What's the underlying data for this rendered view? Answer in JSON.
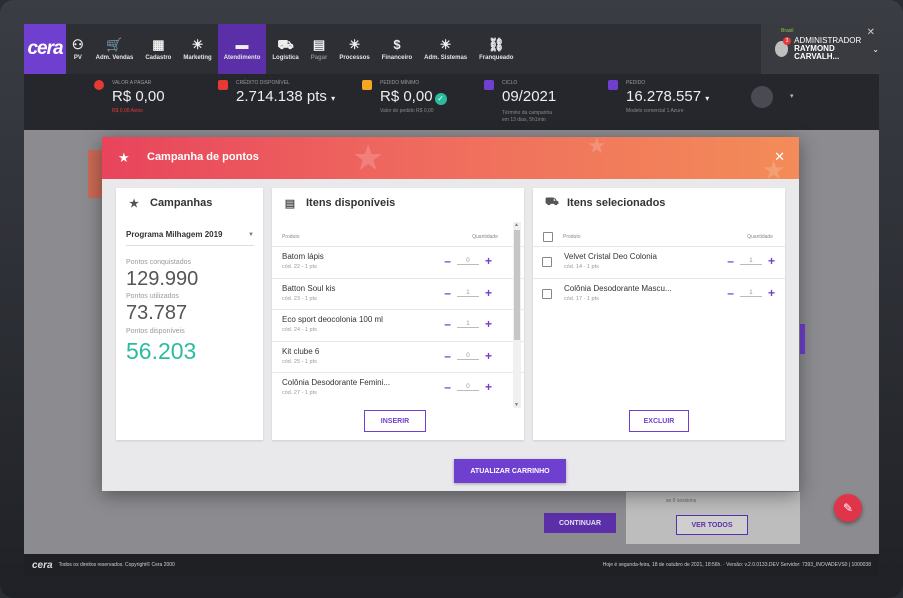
{
  "nav": {
    "logo": "cera",
    "items": [
      {
        "label": "PV",
        "icon": "user-group-icon",
        "glyph": "⚇"
      },
      {
        "label": "Adm. Vendas",
        "icon": "cart-icon",
        "glyph": "🛒"
      },
      {
        "label": "Cadastro",
        "icon": "id-card-icon",
        "glyph": "▦"
      },
      {
        "label": "Marketing",
        "icon": "lightbulb-icon",
        "glyph": "☀"
      },
      {
        "label": "Atendimento",
        "icon": "chat-icon",
        "glyph": "▬"
      },
      {
        "label": "Logística",
        "icon": "truck-icon",
        "glyph": "⛟"
      },
      {
        "label": "Pagar",
        "icon": "invoice-icon",
        "glyph": "▤"
      },
      {
        "label": "Processos",
        "icon": "lightbulb-icon",
        "glyph": "☀"
      },
      {
        "label": "Financeiro",
        "icon": "dollar-icon",
        "glyph": "$"
      },
      {
        "label": "Adm. Sistemas",
        "icon": "lightbulb-icon",
        "glyph": "☀"
      },
      {
        "label": "Franqueado",
        "icon": "network-icon",
        "glyph": "⛓"
      }
    ],
    "active_index": 4,
    "user": {
      "country": "Brasil",
      "role": "ADMINISTRADOR",
      "name": "RAYMOND CARVALH...",
      "badge": "3"
    }
  },
  "info": {
    "valor_pagar": {
      "label": "VALOR A PAGAR",
      "value": "R$ 0,00",
      "sub": "R$ 0,00 Aviso"
    },
    "credito": {
      "label": "CRÉDITO DISPONÍVEL",
      "value": "2.714.138 pts"
    },
    "pedido_minimo": {
      "label": "PEDIDO MÍNIMO",
      "value": "R$ 0,00",
      "sub": "Valor do pedido R$ 0,00"
    },
    "ciclo": {
      "label": "CICLO",
      "value": "09/2021",
      "sub1": "Término da campanha",
      "sub2": "em 13 dias, 5h1min"
    },
    "pedido": {
      "label": "PEDIDO",
      "value": "16.278.557",
      "sub": "Modelo comercial 1 Azure"
    },
    "colors": {
      "red": "#e53935",
      "orange": "#f5a623",
      "purple": "#6f3fd0",
      "green": "#2bbca0"
    }
  },
  "modal": {
    "title": "Campanha de pontos",
    "campanhas": {
      "header": "Campanhas",
      "selected": "Programa Milhagem 2019",
      "conquistados_label": "Pontos conquistados",
      "conquistados": "129.990",
      "utilizados_label": "Pontos utilizados",
      "utilizados": "73.787",
      "disponiveis_label": "Pontos disponíveis",
      "disponiveis": "56.203"
    },
    "disponiveis": {
      "header": "Itens disponíveis",
      "col_produto": "Produto",
      "col_quantidade": "Quantidade",
      "items": [
        {
          "name": "Batom lápis",
          "code": "cód. 22 - 1 pts",
          "qty": "0"
        },
        {
          "name": "Batton Soul kis",
          "code": "cód. 23 - 1 pts",
          "qty": "1"
        },
        {
          "name": "Eco sport deocolonia 100 ml",
          "code": "cód. 24 - 1 pts",
          "qty": "1"
        },
        {
          "name": "Kit clube 6",
          "code": "cód. 25 - 1 pts",
          "qty": "0"
        },
        {
          "name": "Colônia Desodorante Femini...",
          "code": "cód. 27 - 1 pts",
          "qty": "0"
        }
      ],
      "button": "INSERIR"
    },
    "selecionados": {
      "header": "Itens selecionados",
      "col_produto": "Produto",
      "col_quantidade": "Quantidade",
      "items": [
        {
          "name": "Velvet Cristal Deo Colonia",
          "code": "cód. 14 - 1 pts",
          "qty": "1"
        },
        {
          "name": "Colônia Desodorante Mascu...",
          "code": "cód. 17 - 1 pts",
          "qty": "1"
        }
      ],
      "button": "EXCLUIR"
    },
    "primary_button": "ATUALIZAR CARRINHO"
  },
  "background": {
    "continuar": "CONTINUAR",
    "ver_todos": "VER TODOS",
    "card_text": "se 0 sessions"
  },
  "footer": {
    "logo": "cera",
    "left": "Todos os direitos reservados. Copyright© Cera 2000",
    "right": "Hoje é segunda-feira, 18 de outubro de 2021, 18:56h. · Versão: v.2.0.0133.DEV Servidor: 7393_INOVADEVS0 | 1000038"
  }
}
